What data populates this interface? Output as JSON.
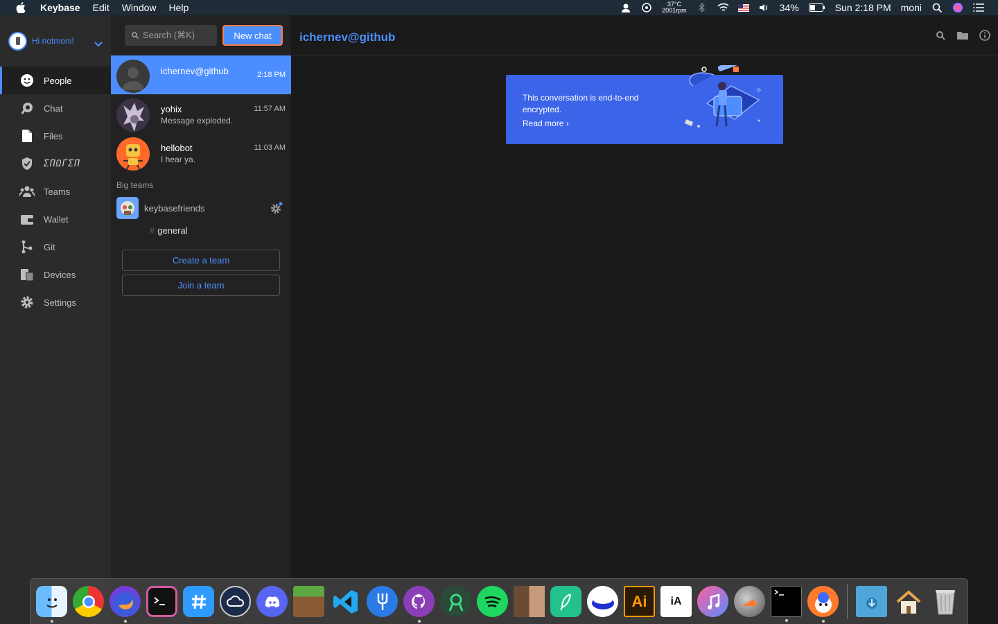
{
  "menubar": {
    "app_name": "Keybase",
    "menus": [
      "Edit",
      "Window",
      "Help"
    ],
    "temp": "37°C",
    "rpm": "2001rpm",
    "battery": "34%",
    "clock": "Sun 2:18 PM",
    "user": "moni"
  },
  "user": {
    "greeting": "Hi notmoni!"
  },
  "nav": {
    "items": [
      {
        "label": "People",
        "icon": "people-icon"
      },
      {
        "label": "Chat",
        "icon": "chat-icon"
      },
      {
        "label": "Files",
        "icon": "files-icon"
      },
      {
        "label": "ΣΠΩΓΣΠ",
        "icon": "shield-icon"
      },
      {
        "label": "Teams",
        "icon": "teams-icon"
      },
      {
        "label": "Wallet",
        "icon": "wallet-icon"
      },
      {
        "label": "Git",
        "icon": "git-icon"
      },
      {
        "label": "Devices",
        "icon": "devices-icon"
      },
      {
        "label": "Settings",
        "icon": "gear-icon"
      }
    ]
  },
  "convlist": {
    "search_placeholder": "Search (⌘K)",
    "new_chat_label": "New chat",
    "conversations": [
      {
        "name": "ichernev@github",
        "time": "2:18 PM",
        "snippet": ""
      },
      {
        "name": "yohix",
        "time": "11:57 AM",
        "snippet": "Message exploded."
      },
      {
        "name": "hellobot",
        "time": "11:03 AM",
        "snippet": "I hear ya."
      }
    ],
    "big_teams_label": "Big teams",
    "team": {
      "name": "keybasefriends",
      "channel": "general"
    },
    "create_team_label": "Create a team",
    "join_team_label": "Join a team"
  },
  "main": {
    "title": "ichernev@github",
    "banner_text": "This conversation is end-to-end encrypted.",
    "banner_link": "Read more ›"
  },
  "dock": {
    "apps": [
      "Finder",
      "Chrome",
      "Firefox",
      "iTerm",
      "Keybase Chat",
      "Creative Cloud",
      "Discord",
      "Minecraft",
      "VS Code",
      "Fork",
      "GitHub Desktop",
      "Android Studio",
      "Spotify",
      "Game",
      "Feather",
      "Mirror",
      "Illustrator",
      "iA Writer",
      "iTunes",
      "Oven",
      "Terminal",
      "Keybase"
    ],
    "colors": {
      "accent": "#4c8eff",
      "banner": "#3b64e8"
    }
  }
}
